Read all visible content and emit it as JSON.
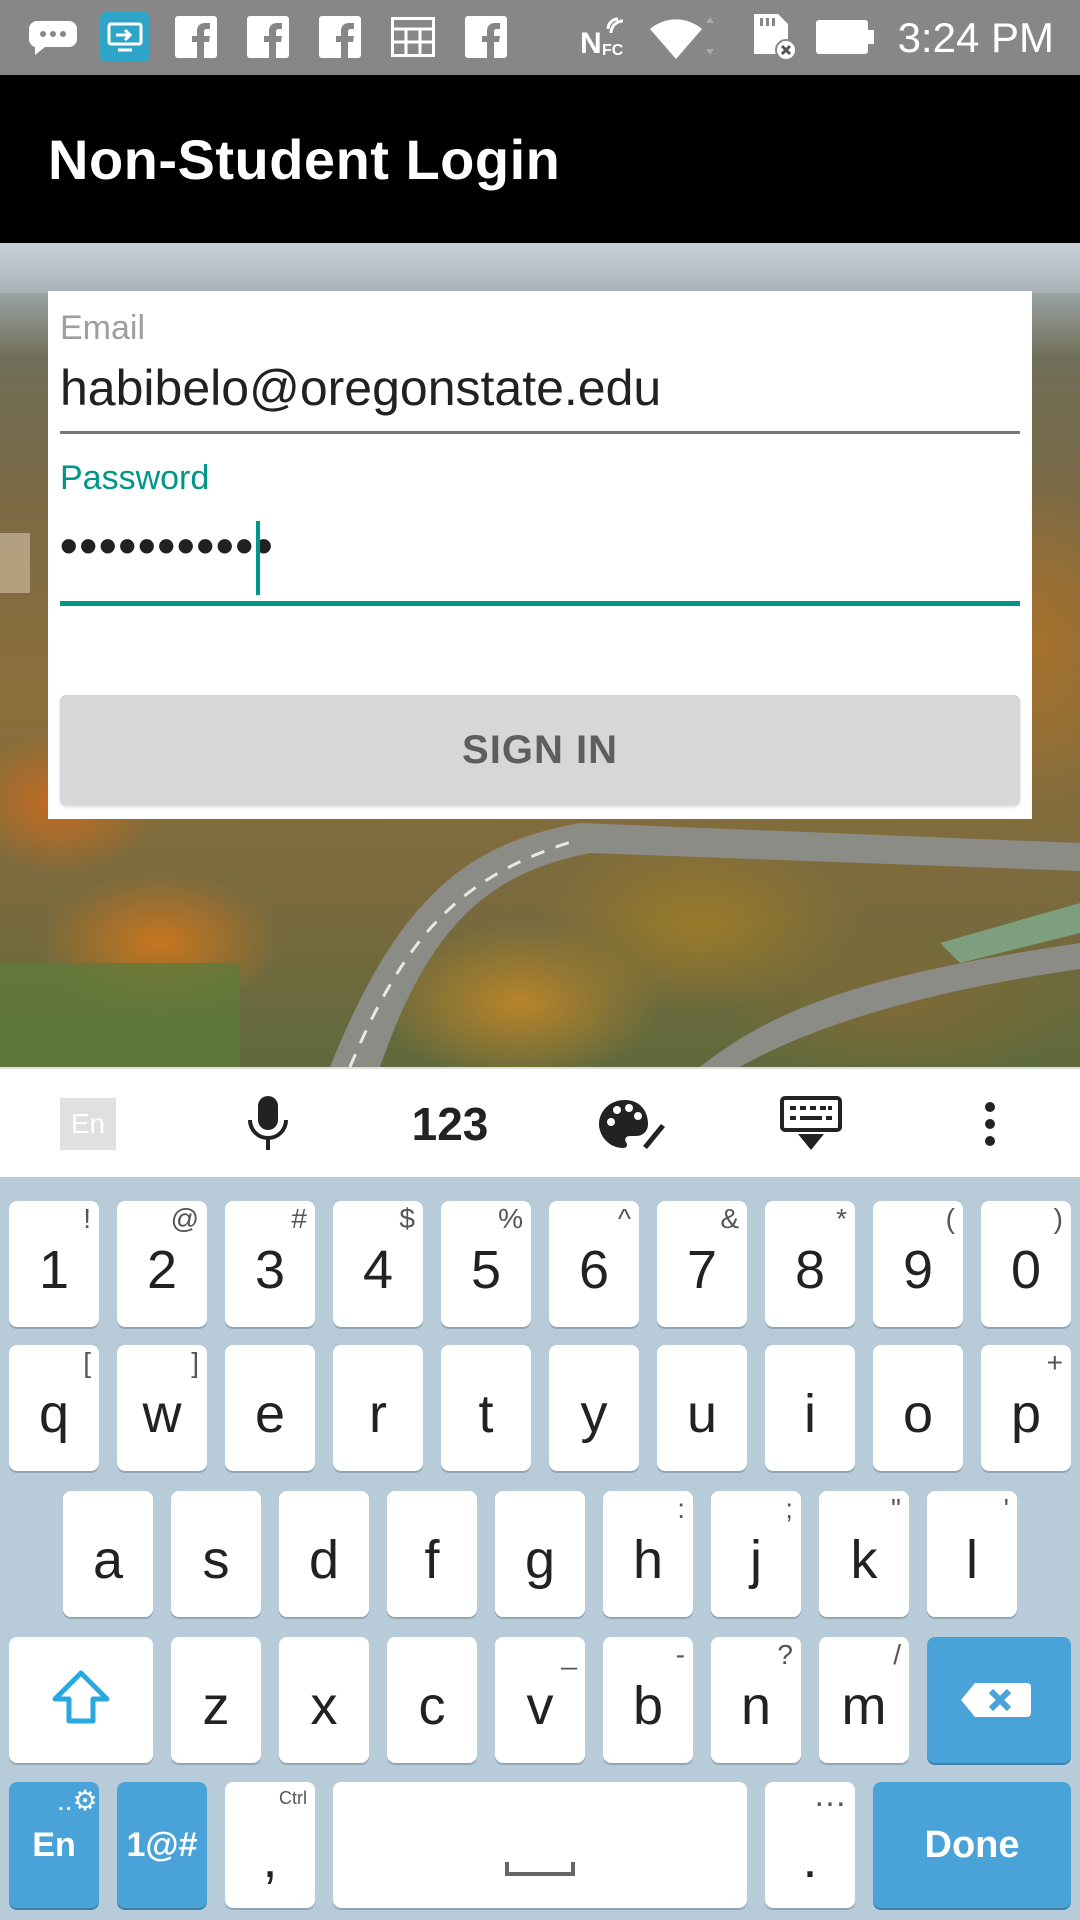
{
  "status_bar": {
    "time": "3:24 PM",
    "icons": [
      "messenger-icon",
      "screen-share-icon",
      "facebook-icon",
      "facebook-icon",
      "facebook-icon",
      "calendar-icon",
      "facebook-icon",
      "nfc-icon",
      "wifi-icon",
      "no-sd-card-icon",
      "battery-icon"
    ],
    "nfc_label": "N"
  },
  "app_bar": {
    "title": "Non-Student Login"
  },
  "form": {
    "email_label": "Email",
    "email_value": "habibelo@oregonstate.edu",
    "password_label": "Password",
    "password_value": "•••••••••••",
    "signin_label": "SIGN IN",
    "accent_color": "#009688"
  },
  "keyboard_toolbar": {
    "language": "En",
    "numbers_label": "123",
    "items": [
      "language-icon",
      "microphone-icon",
      "numbers-toggle",
      "palette-icon",
      "hide-keyboard-icon",
      "more-menu-icon"
    ]
  },
  "keyboard": {
    "row1": [
      {
        "key": "1",
        "sub": "!"
      },
      {
        "key": "2",
        "sub": "@"
      },
      {
        "key": "3",
        "sub": "#"
      },
      {
        "key": "4",
        "sub": "$"
      },
      {
        "key": "5",
        "sub": "%"
      },
      {
        "key": "6",
        "sub": "^"
      },
      {
        "key": "7",
        "sub": "&"
      },
      {
        "key": "8",
        "sub": "*"
      },
      {
        "key": "9",
        "sub": "("
      },
      {
        "key": "0",
        "sub": ")"
      }
    ],
    "row2": [
      {
        "key": "q",
        "sub": "["
      },
      {
        "key": "w",
        "sub": "]"
      },
      {
        "key": "e",
        "sub": ""
      },
      {
        "key": "r",
        "sub": ""
      },
      {
        "key": "t",
        "sub": ""
      },
      {
        "key": "y",
        "sub": ""
      },
      {
        "key": "u",
        "sub": ""
      },
      {
        "key": "i",
        "sub": ""
      },
      {
        "key": "o",
        "sub": ""
      },
      {
        "key": "p",
        "sub": "+"
      }
    ],
    "row3": [
      {
        "key": "a",
        "sub": ""
      },
      {
        "key": "s",
        "sub": ""
      },
      {
        "key": "d",
        "sub": ""
      },
      {
        "key": "f",
        "sub": ""
      },
      {
        "key": "g",
        "sub": ""
      },
      {
        "key": "h",
        "sub": ":"
      },
      {
        "key": "j",
        "sub": ";"
      },
      {
        "key": "k",
        "sub": "\""
      },
      {
        "key": "l",
        "sub": "'"
      }
    ],
    "row4": [
      {
        "key": "z",
        "sub": ""
      },
      {
        "key": "x",
        "sub": ""
      },
      {
        "key": "c",
        "sub": ""
      },
      {
        "key": "v",
        "sub": "_"
      },
      {
        "key": "b",
        "sub": "-"
      },
      {
        "key": "n",
        "sub": "?"
      },
      {
        "key": "m",
        "sub": "/"
      }
    ],
    "bottom": {
      "lang": "En",
      "symbols": "1@#",
      "comma": ",",
      "comma_sub": "Ctrl",
      "period": ".",
      "period_sub": "…",
      "done": "Done"
    },
    "key_color": "#ffffff",
    "action_key_color": "#4aa3d8",
    "background_color": "#b7cbd8"
  }
}
